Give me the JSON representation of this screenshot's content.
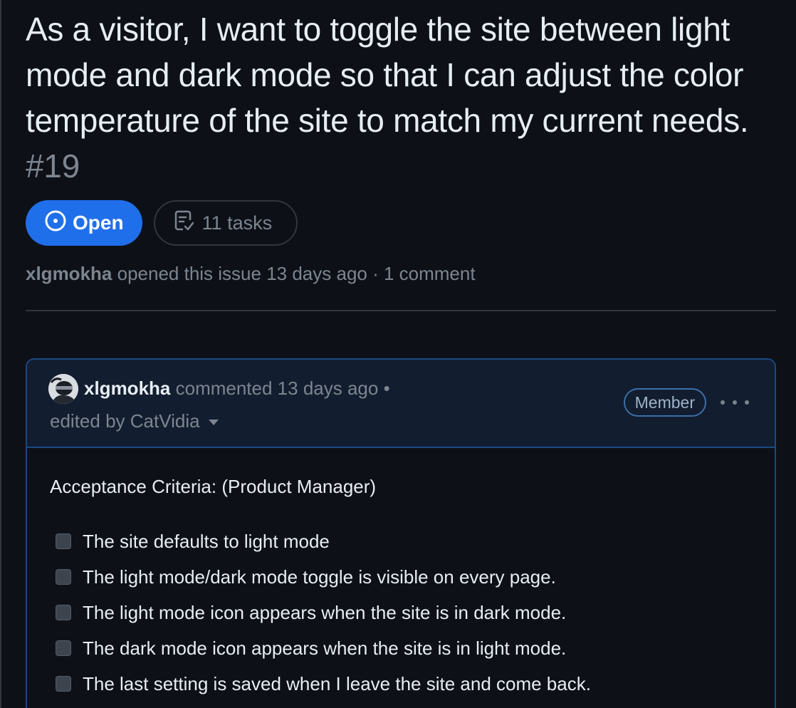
{
  "issue": {
    "title": "As a visitor, I want to toggle the site between light mode and dark mode so that I can adjust the color temperature of the site to match my current needs.",
    "number": "#19",
    "state_label": "Open",
    "tasks_label": "11 tasks",
    "author": "xlgmokha",
    "opened_text": "opened this issue 13 days ago · 1 comment"
  },
  "comment": {
    "author": "xlgmokha",
    "commented_text": "commented 13 days ago •",
    "edited_text": "edited by CatVidia",
    "role": "Member",
    "acceptance_title": "Acceptance Criteria: (Product Manager)",
    "tasks": [
      "The site defaults to light mode",
      "The light mode/dark mode toggle is visible on every page.",
      "The light mode icon appears when the site is in dark mode.",
      "The dark mode icon appears when the site is in light mode.",
      "The last setting is saved when I leave the site and come back."
    ]
  },
  "colors": {
    "background": "#0d1117",
    "accent": "#1f6feb",
    "muted": "#7d8590",
    "text": "#e6edf3"
  },
  "icons": {
    "state": "issue-opened-icon",
    "tasks": "checklist-icon",
    "menu": "kebab-horizontal-icon"
  }
}
